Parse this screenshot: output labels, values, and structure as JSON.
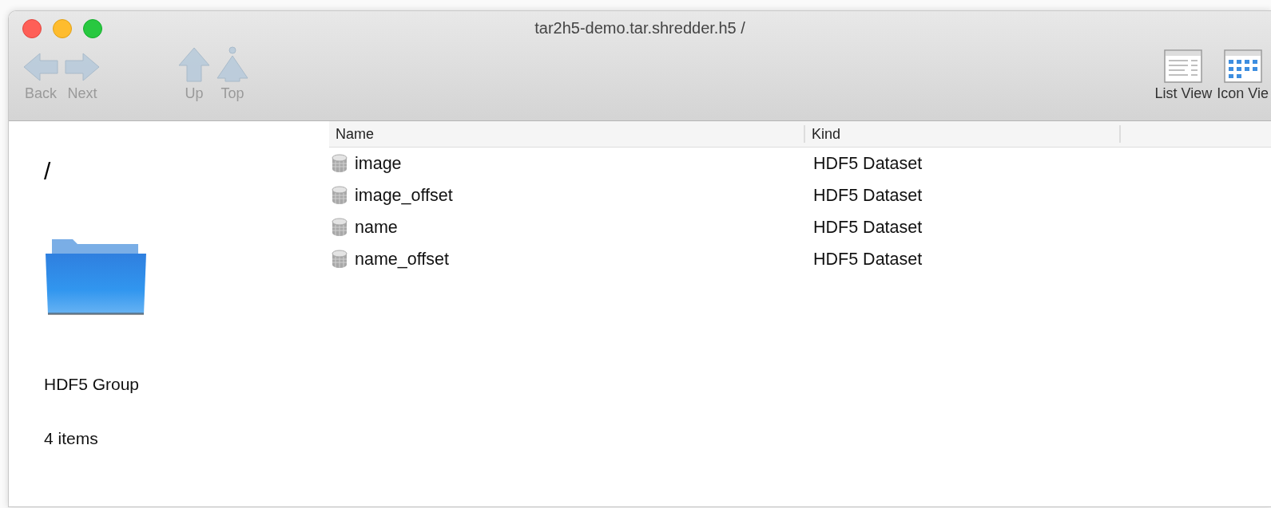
{
  "window": {
    "title": "tar2h5-demo.tar.shredder.h5 /"
  },
  "toolbar": {
    "left": [
      {
        "kind": "back",
        "label": "Back",
        "disabled": true
      },
      {
        "kind": "next",
        "label": "Next",
        "disabled": true
      },
      {
        "kind": "up",
        "label": "Up",
        "disabled": true
      },
      {
        "kind": "top",
        "label": "Top",
        "disabled": true
      }
    ],
    "right": [
      {
        "kind": "list",
        "label": "List View",
        "disabled": false
      },
      {
        "kind": "icon",
        "label": "Icon Vie",
        "disabled": false
      }
    ]
  },
  "info_pane": {
    "path": "/",
    "kind": "HDF5 Group",
    "count": "4 items"
  },
  "table": {
    "columns": [
      "Name",
      "Kind"
    ],
    "rows": [
      {
        "name": "image",
        "kind": "HDF5 Dataset"
      },
      {
        "name": "image_offset",
        "kind": "HDF5 Dataset"
      },
      {
        "name": "name",
        "kind": "HDF5 Dataset"
      },
      {
        "name": "name_offset",
        "kind": "HDF5 Dataset"
      }
    ]
  }
}
